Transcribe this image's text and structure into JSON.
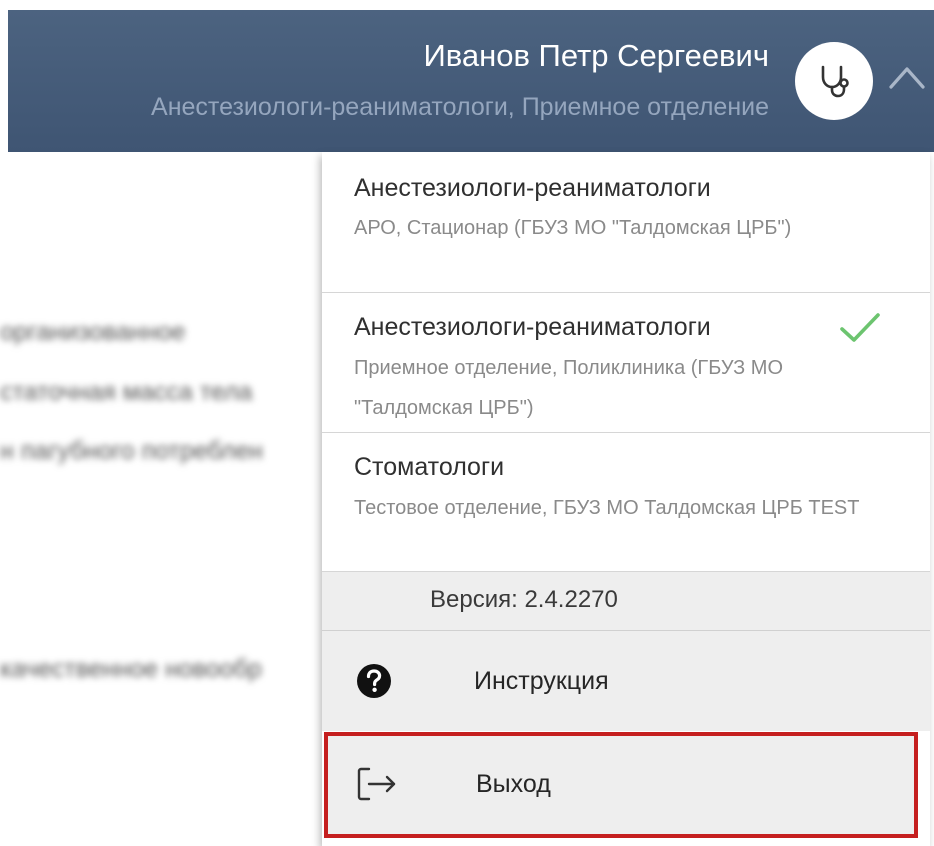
{
  "header": {
    "user_name": "Иванов Петр Сергеевич",
    "user_role": "Анестезиологи-реаниматологи, Приемное отделение",
    "avatar_icon": "stethoscope-icon",
    "toggle_icon": "chevron-up-icon",
    "background_color": "#43597a"
  },
  "background": {
    "lines": [
      "организованное",
      "статочная масса тела",
      "н пагубного потреблен",
      "качественное новообр"
    ]
  },
  "dropdown": {
    "positions": [
      {
        "title": "Анестезиологи-реаниматологи",
        "subtitle": "АРО, Стационар (ГБУЗ МО \"Талдомская ЦРБ\")",
        "selected": false
      },
      {
        "title": "Анестезиологи-реаниматологи",
        "subtitle": "Приемное отделение, Поликлиника (ГБУЗ МО \"Талдомская ЦРБ\")",
        "selected": true,
        "selected_icon": "checkmark-icon",
        "selected_color": "#6cc46f"
      },
      {
        "title": "Стоматологи",
        "subtitle": "Тестовое отделение, ГБУЗ МО Талдомская ЦРБ TEST",
        "selected": false
      }
    ],
    "version_label": "Версия: 2.4.2270",
    "instruction": {
      "label": "Инструкция",
      "icon": "help-circle-icon"
    },
    "logout": {
      "label": "Выход",
      "icon": "logout-icon",
      "highlight_color": "#c51f1f"
    }
  }
}
